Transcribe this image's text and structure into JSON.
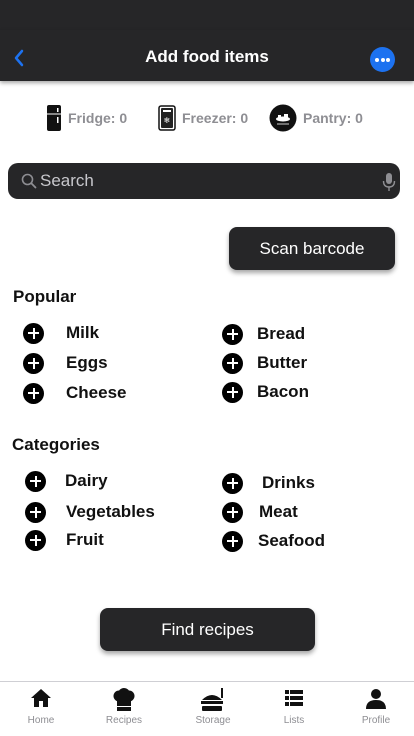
{
  "header": {
    "title": "Add food items",
    "back_icon": "chevron-left-icon",
    "more_icon": "ellipsis-icon",
    "accent_color": "#1d72f0",
    "bar_color": "#262628"
  },
  "storage": [
    {
      "label": "Fridge: 0",
      "icon": "fridge-icon"
    },
    {
      "label": "Freezer: 0",
      "icon": "freezer-icon"
    },
    {
      "label": "Pantry: 0",
      "icon": "pantry-icon"
    }
  ],
  "search": {
    "placeholder": "Search",
    "value": ""
  },
  "scan_button": "Scan barcode",
  "popular": {
    "heading": "Popular",
    "items": [
      "Milk",
      "Bread",
      "Eggs",
      "Butter",
      "Cheese",
      "Bacon"
    ]
  },
  "categories": {
    "heading": "Categories",
    "items": [
      "Dairy",
      "Drinks",
      "Vegetables",
      "Meat",
      "Fruit",
      "Seafood"
    ]
  },
  "find_button": "Find recipes",
  "tabs": [
    {
      "label": "Home",
      "icon": "home-icon"
    },
    {
      "label": "Recipes",
      "icon": "chef-hat-icon"
    },
    {
      "label": "Storage",
      "icon": "storage-icon"
    },
    {
      "label": "Lists",
      "icon": "list-icon"
    },
    {
      "label": "Profile",
      "icon": "profile-icon"
    }
  ]
}
